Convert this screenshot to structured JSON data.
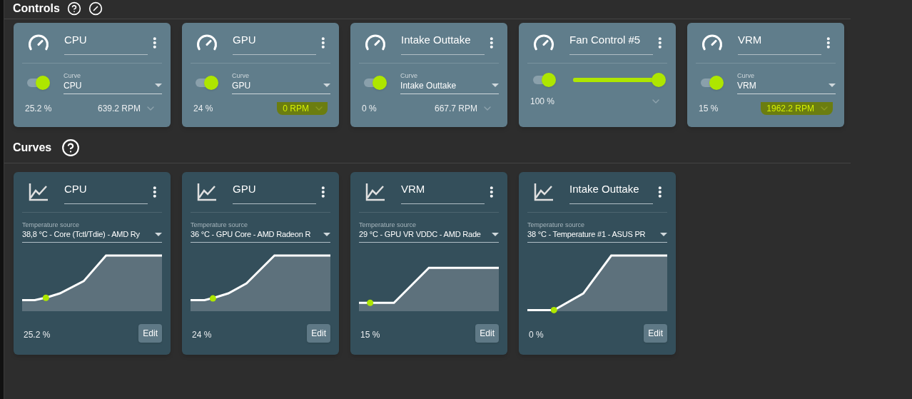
{
  "controls": {
    "title": "Controls",
    "cards": [
      {
        "kind": "curve",
        "name": "CPU",
        "on": true,
        "curve_label": "Curve",
        "curve": "CPU",
        "percent": "25.2 %",
        "rpm": "639.2 RPM",
        "highlighted": false
      },
      {
        "kind": "curve",
        "name": "GPU",
        "on": true,
        "curve_label": "Curve",
        "curve": "GPU",
        "percent": "24 %",
        "rpm": "0 RPM",
        "highlighted": true
      },
      {
        "kind": "curve",
        "name": "Intake Outtake",
        "on": true,
        "curve_label": "Curve",
        "curve": "Intake Outtake",
        "percent": "0 %",
        "rpm": "667.7 RPM",
        "highlighted": false
      },
      {
        "kind": "slider",
        "name": "Fan Control #5",
        "on": true,
        "level": 1,
        "percent": "100 %"
      },
      {
        "kind": "curve",
        "name": "VRM",
        "on": true,
        "curve_label": "Curve",
        "curve": "VRM",
        "percent": "15 %",
        "rpm": "1962.2 RPM",
        "highlighted": true
      }
    ]
  },
  "curves": {
    "title": "Curves",
    "cards": [
      {
        "name": "CPU",
        "source_label": "Temperature source",
        "source": "38,8 °C - Core (Tctl/Tdie) - AMD Ry",
        "percent": "25.2 %",
        "button": "Edit"
      },
      {
        "name": "GPU",
        "source_label": "Temperature source",
        "source": "36 °C - GPU Core - AMD Radeon R",
        "percent": "24 %",
        "button": "Edit"
      },
      {
        "name": "VRM",
        "source_label": "Temperature source",
        "source": "29 °C - GPU VR VDDC - AMD Rade",
        "percent": "15 %",
        "button": "Edit"
      },
      {
        "name": "Intake Outtake",
        "source_label": "Temperature source",
        "source": "38 °C - Temperature #1 - ASUS PR",
        "percent": "0 %",
        "button": "Edit"
      }
    ]
  }
}
